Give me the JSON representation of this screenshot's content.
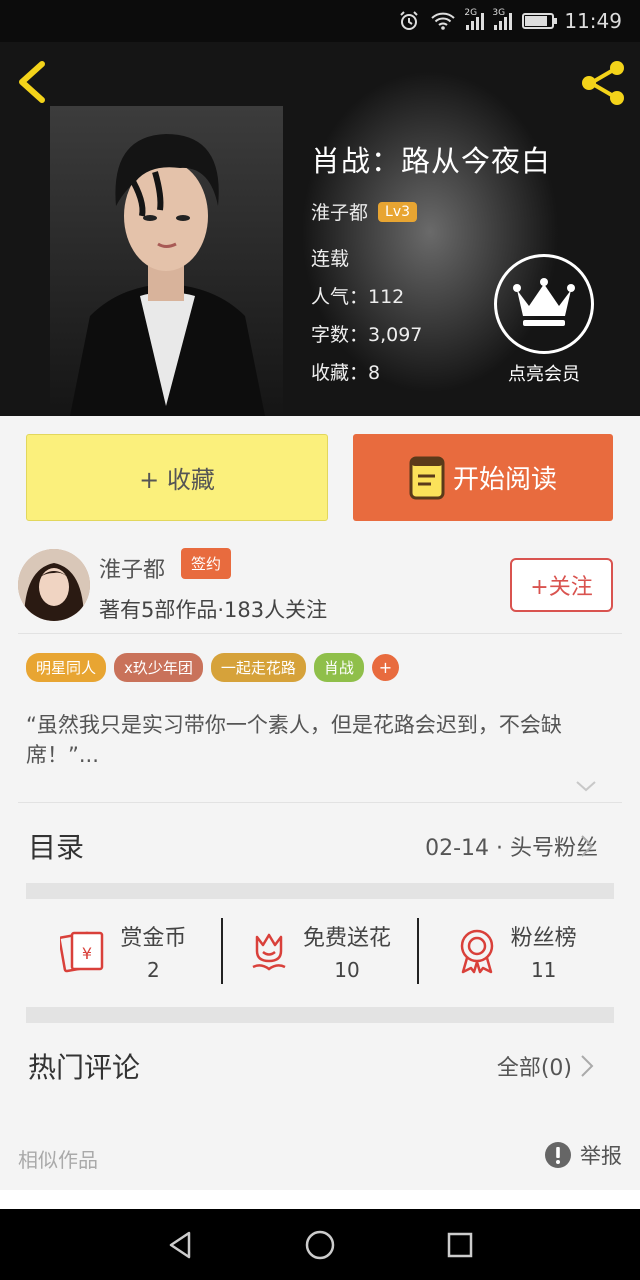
{
  "status_bar": {
    "time": "11:49",
    "net1": "2G",
    "net2": "3G"
  },
  "book": {
    "title": "肖战：路从今夜白",
    "author": "淮子都",
    "level": "Lv3",
    "status": "连载",
    "popularity": "人气：112",
    "word_count": "字数：3,097",
    "favorites": "收藏：8"
  },
  "vip": {
    "label": "点亮会员"
  },
  "actions": {
    "favorite_label": "+ 收藏",
    "read_label": "开始阅读"
  },
  "author_card": {
    "name": "淮子都",
    "badge": "签约",
    "stats": "著有5部作品·183人关注",
    "follow_label": "+关注"
  },
  "tags": [
    {
      "label": "明星同人",
      "color": "#e8a532"
    },
    {
      "label": "x玖少年团",
      "color": "#c9725a"
    },
    {
      "label": "一起走花路",
      "color": "#d6a23a"
    },
    {
      "label": "肖战",
      "color": "#8fbf4a"
    }
  ],
  "tag_more": "+",
  "description": "“虽然我只是实习带你一个素人，但是花路会迟到，不会缺席！”...",
  "catalog": {
    "title": "目录",
    "latest": "02-14 · 头号粉丝"
  },
  "rewards": [
    {
      "label": "赏金币",
      "value": "2",
      "icon": "red-envelope-icon"
    },
    {
      "label": "免费送花",
      "value": "10",
      "icon": "flower-icon"
    },
    {
      "label": "粉丝榜",
      "value": "11",
      "icon": "medal-icon"
    }
  ],
  "comments": {
    "title": "热门评论",
    "all_label": "全部(0)"
  },
  "similar": {
    "label": "相似作品"
  },
  "report": {
    "label": "举报"
  },
  "colors": {
    "accent": "#e86b3e",
    "favorite_bg": "#fbf07c",
    "follow": "#d9534f",
    "level_badge": "#e8a532"
  }
}
